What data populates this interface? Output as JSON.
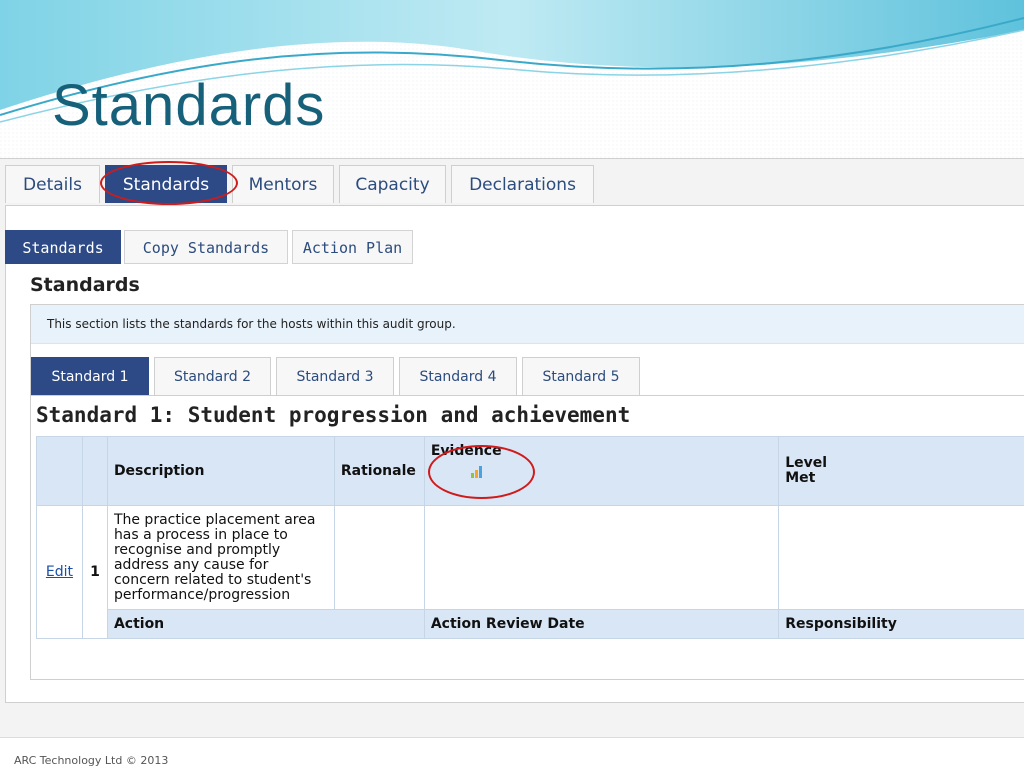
{
  "slide": {
    "title": "Standards"
  },
  "main_tabs": [
    "Details",
    "Standards",
    "Mentors",
    "Capacity",
    "Declarations"
  ],
  "sub_tabs": [
    "Standards",
    "Copy Standards",
    "Action Plan"
  ],
  "section": {
    "title": "Standards",
    "info": "This section lists the standards for the hosts within this audit group."
  },
  "standard_tabs": [
    "Standard 1",
    "Standard 2",
    "Standard 3",
    "Standard 4",
    "Standard 5"
  ],
  "standard": {
    "heading": "Standard 1: Student progression and achievement",
    "columns": {
      "description": "Description",
      "rationale": "Rationale",
      "evidence": "Evidence",
      "level_met_line1": "Level",
      "level_met_line2": "Met"
    },
    "row": {
      "edit": "Edit",
      "number": "1",
      "description": "The practice placement area has a process in place to recognise and promptly address any cause for concern related to student's performance/progression",
      "rationale": "",
      "evidence": "",
      "level_met": ""
    },
    "action_columns": {
      "action": "Action",
      "review_date": "Action Review Date",
      "responsibility": "Responsibility"
    }
  },
  "footer": {
    "text": "ARC Technology Ltd © 2013"
  },
  "colors": {
    "accent": "#2d4a86",
    "title": "#17607a",
    "annotation": "#d11a1a",
    "header_bg": "#d9e6f6"
  },
  "icons": {
    "evidence": "bar-chart-icon"
  }
}
